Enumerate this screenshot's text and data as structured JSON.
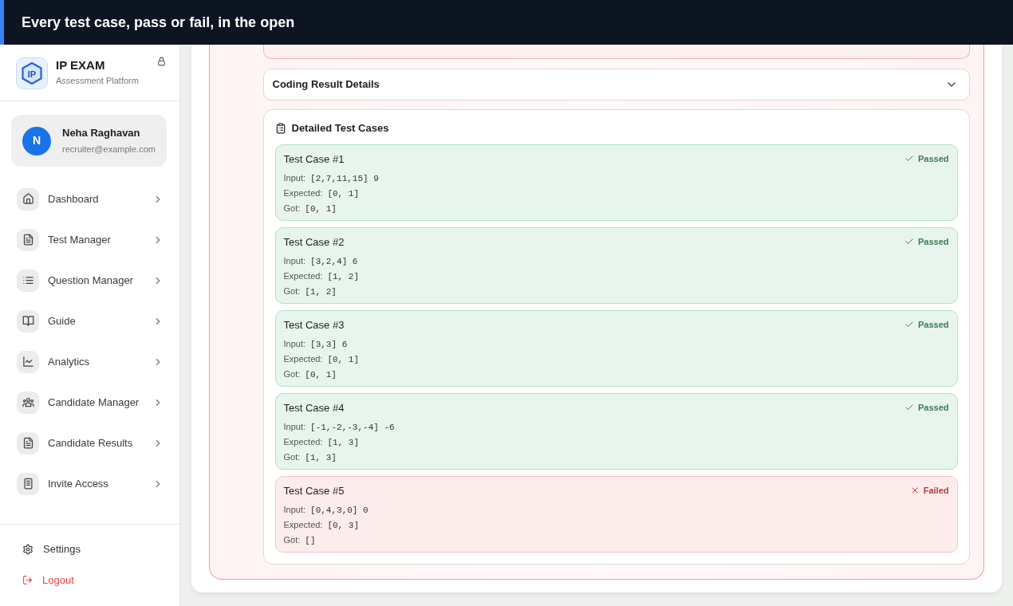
{
  "banner": {
    "title": "Every test case, pass or fail, in the open"
  },
  "sidebar": {
    "brand": {
      "logo_text": "IP",
      "name": "IP EXAM",
      "tagline": "Assessment Platform"
    },
    "user": {
      "initial": "N",
      "name": "Neha Raghavan",
      "email": "recruiter@example.com"
    },
    "nav_items": [
      {
        "label": "Dashboard"
      },
      {
        "label": "Test Manager"
      },
      {
        "label": "Question Manager"
      },
      {
        "label": "Guide"
      },
      {
        "label": "Analytics"
      },
      {
        "label": "Candidate Manager"
      },
      {
        "label": "Candidate Results"
      },
      {
        "label": "Invite Access"
      }
    ],
    "footer_items": [
      {
        "kind": "settings",
        "label": "Settings"
      },
      {
        "kind": "logout",
        "label": "Logout"
      }
    ]
  },
  "main": {
    "coding_details": {
      "title": "Coding Result Details",
      "expanded": false
    },
    "test_cases": {
      "title": "Detailed Test Cases",
      "items": [
        {
          "title": "Test Case #1",
          "passed": true,
          "status": "Passed",
          "lines": [
            {
              "label": "Input:",
              "value": "[2,7,11,15] 9"
            },
            {
              "label": "Expected:",
              "value": "[0, 1]"
            },
            {
              "label": "Got:",
              "value": "[0, 1]"
            }
          ]
        },
        {
          "title": "Test Case #2",
          "passed": true,
          "status": "Passed",
          "lines": [
            {
              "label": "Input:",
              "value": "[3,2,4] 6"
            },
            {
              "label": "Expected:",
              "value": "[1, 2]"
            },
            {
              "label": "Got:",
              "value": "[1, 2]"
            }
          ]
        },
        {
          "title": "Test Case #3",
          "passed": true,
          "status": "Passed",
          "lines": [
            {
              "label": "Input:",
              "value": "[3,3] 6"
            },
            {
              "label": "Expected:",
              "value": "[0, 1]"
            },
            {
              "label": "Got:",
              "value": "[0, 1]"
            }
          ]
        },
        {
          "title": "Test Case #4",
          "passed": true,
          "status": "Passed",
          "lines": [
            {
              "label": "Input:",
              "value": "[-1,-2,-3,-4] -6"
            },
            {
              "label": "Expected:",
              "value": "[1, 3]"
            },
            {
              "label": "Got:",
              "value": "[1, 3]"
            }
          ]
        },
        {
          "title": "Test Case #5",
          "passed": false,
          "status": "Failed",
          "lines": [
            {
              "label": "Input:",
              "value": "[0,4,3,0] 0"
            },
            {
              "label": "Expected:",
              "value": "[0, 3]"
            },
            {
              "label": "Got:",
              "value": "[]"
            }
          ]
        }
      ]
    }
  }
}
